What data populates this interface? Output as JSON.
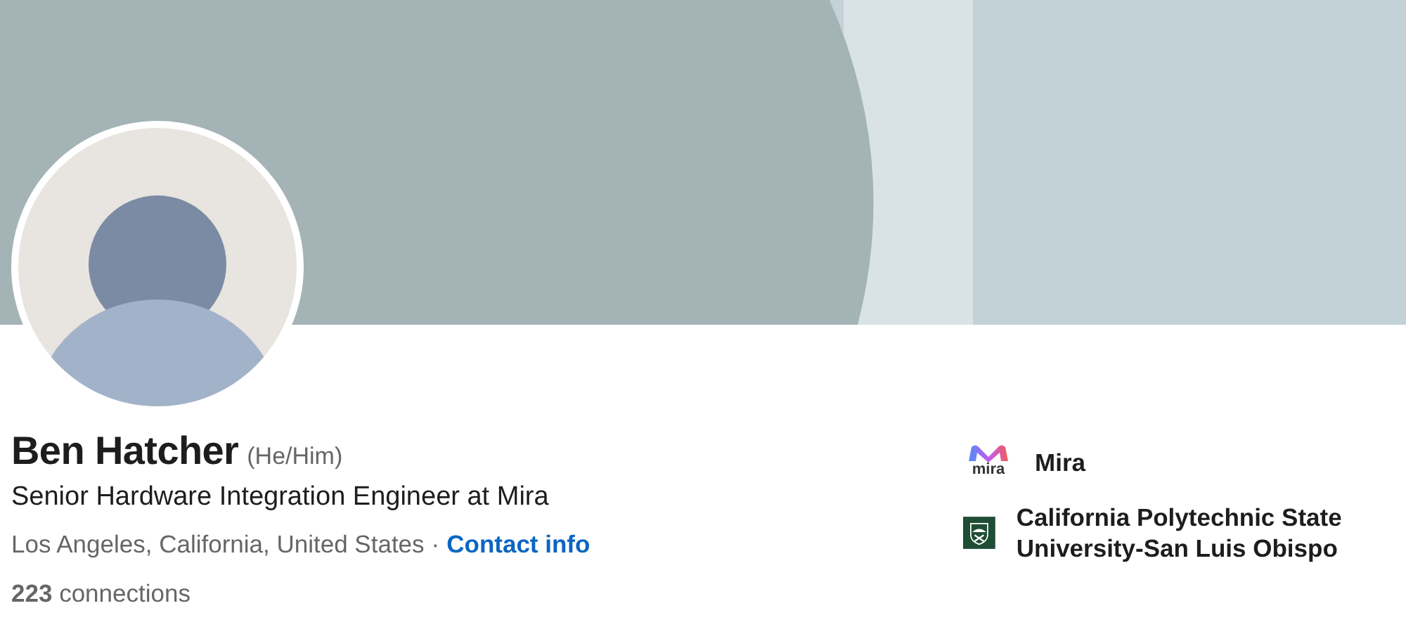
{
  "profile": {
    "name": "Ben Hatcher",
    "pronouns": "(He/Him)",
    "headline": "Senior Hardware Integration Engineer at Mira",
    "location": "Los Angeles, California, United States",
    "separator": "·",
    "contact_link": "Contact info",
    "connections": "**223** connections"
  },
  "affiliations": [
    {
      "kind": "company",
      "logo_text": "mira",
      "name": "Mira"
    },
    {
      "kind": "school",
      "name": "California Polytechnic State University-San Luis Obispo"
    }
  ]
}
